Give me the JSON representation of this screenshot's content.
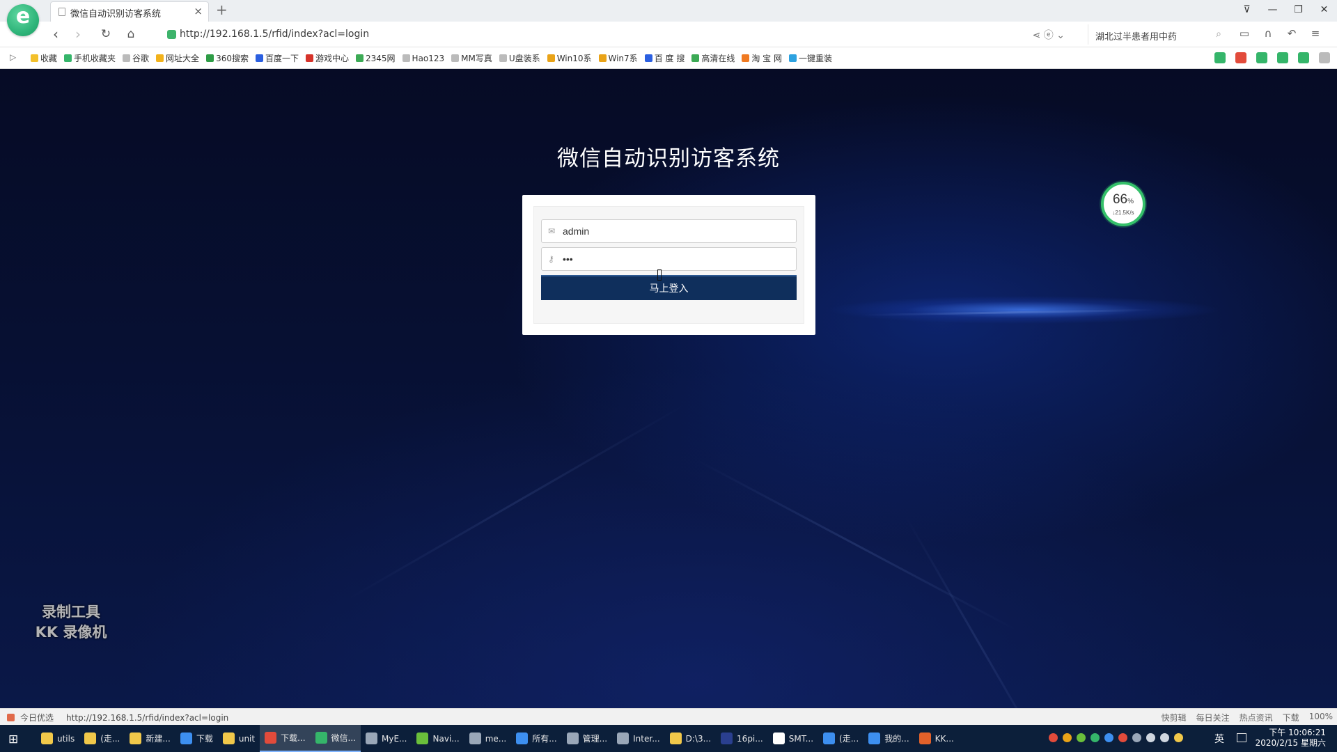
{
  "browser": {
    "tab_title": "微信自动识别访客系统",
    "tab_close": "×",
    "new_tab": "+",
    "window_buttons": [
      "⊽",
      "—",
      "❐",
      "✕"
    ],
    "url": "http://192.168.1.5/rfid/index?acl=login",
    "search_text": "湖北过半患者用中药",
    "bookmarks": [
      {
        "label": "收藏",
        "color": "#f3c02b"
      },
      {
        "label": "手机收藏夹",
        "color": "#35b56a"
      },
      {
        "label": "谷歌",
        "color": "#bbbbbb"
      },
      {
        "label": "网址大全",
        "color": "#f2b21b"
      },
      {
        "label": "360搜索",
        "color": "#2e9c46"
      },
      {
        "label": "百度一下",
        "color": "#2b5fe0"
      },
      {
        "label": "游戏中心",
        "color": "#d6332a"
      },
      {
        "label": "2345网",
        "color": "#3caa55"
      },
      {
        "label": "Hao123",
        "color": "#bbbbbb"
      },
      {
        "label": "MM写真",
        "color": "#bbbbbb"
      },
      {
        "label": "U盘装系",
        "color": "#bbbbbb"
      },
      {
        "label": "Win10系",
        "color": "#e9a318"
      },
      {
        "label": "Win7系",
        "color": "#e9a318"
      },
      {
        "label": "百 度 搜",
        "color": "#2b5fe0"
      },
      {
        "label": "高清在线",
        "color": "#3caa55"
      },
      {
        "label": "淘 宝 网",
        "color": "#f07a22"
      },
      {
        "label": "一键重装",
        "color": "#2da2e0"
      }
    ]
  },
  "page": {
    "title": "微信自动识别访客系统",
    "username_value": "admin",
    "password_value": "abc",
    "login_button": "马上登入",
    "speed_percent": "66",
    "percent_sign": "%",
    "speed_rate": "↓21.5K/s",
    "watermark_line1": "录制工具",
    "watermark_line2": "KK 录像机"
  },
  "statusbar": {
    "left_label": "今日优选",
    "url": "http://192.168.1.5/rfid/index?acl=login",
    "right_items": [
      "快剪辑",
      "每日关注",
      "热点资讯",
      "下载",
      "100%"
    ]
  },
  "taskbar": {
    "items": [
      {
        "label": "utils",
        "color": "#f1c84a",
        "active": false
      },
      {
        "label": "(走...",
        "color": "#f1c84a",
        "active": false
      },
      {
        "label": "新建...",
        "color": "#f1c84a",
        "active": false
      },
      {
        "label": "下载",
        "color": "#3d8ff0",
        "active": false
      },
      {
        "label": "unit",
        "color": "#f1c84a",
        "active": false
      },
      {
        "label": "下载...",
        "color": "#e24b3b",
        "active": true
      },
      {
        "label": "微信...",
        "color": "#35b56a",
        "active": true
      },
      {
        "label": "MyE...",
        "color": "#9aa7b8",
        "active": false
      },
      {
        "label": "Navi...",
        "color": "#6abf3b",
        "active": false
      },
      {
        "label": "me...",
        "color": "#9aa7b8",
        "active": false
      },
      {
        "label": "所有...",
        "color": "#3d8ff0",
        "active": false
      },
      {
        "label": "管理...",
        "color": "#9aa7b8",
        "active": false
      },
      {
        "label": "Inter...",
        "color": "#9aa7b8",
        "active": false
      },
      {
        "label": "D:\\3...",
        "color": "#f1c84a",
        "active": false
      },
      {
        "label": "16pi...",
        "color": "#2a3f8f",
        "active": false
      },
      {
        "label": "SMT...",
        "color": "#ffffff",
        "active": false
      },
      {
        "label": "(走...",
        "color": "#3d8ff0",
        "active": false
      },
      {
        "label": "我的...",
        "color": "#3d8ff0",
        "active": false
      },
      {
        "label": "KK...",
        "color": "#e2612a",
        "active": false
      }
    ],
    "lang": "英",
    "time": "下午 10:06:21",
    "date": "2020/2/15 星期六"
  }
}
